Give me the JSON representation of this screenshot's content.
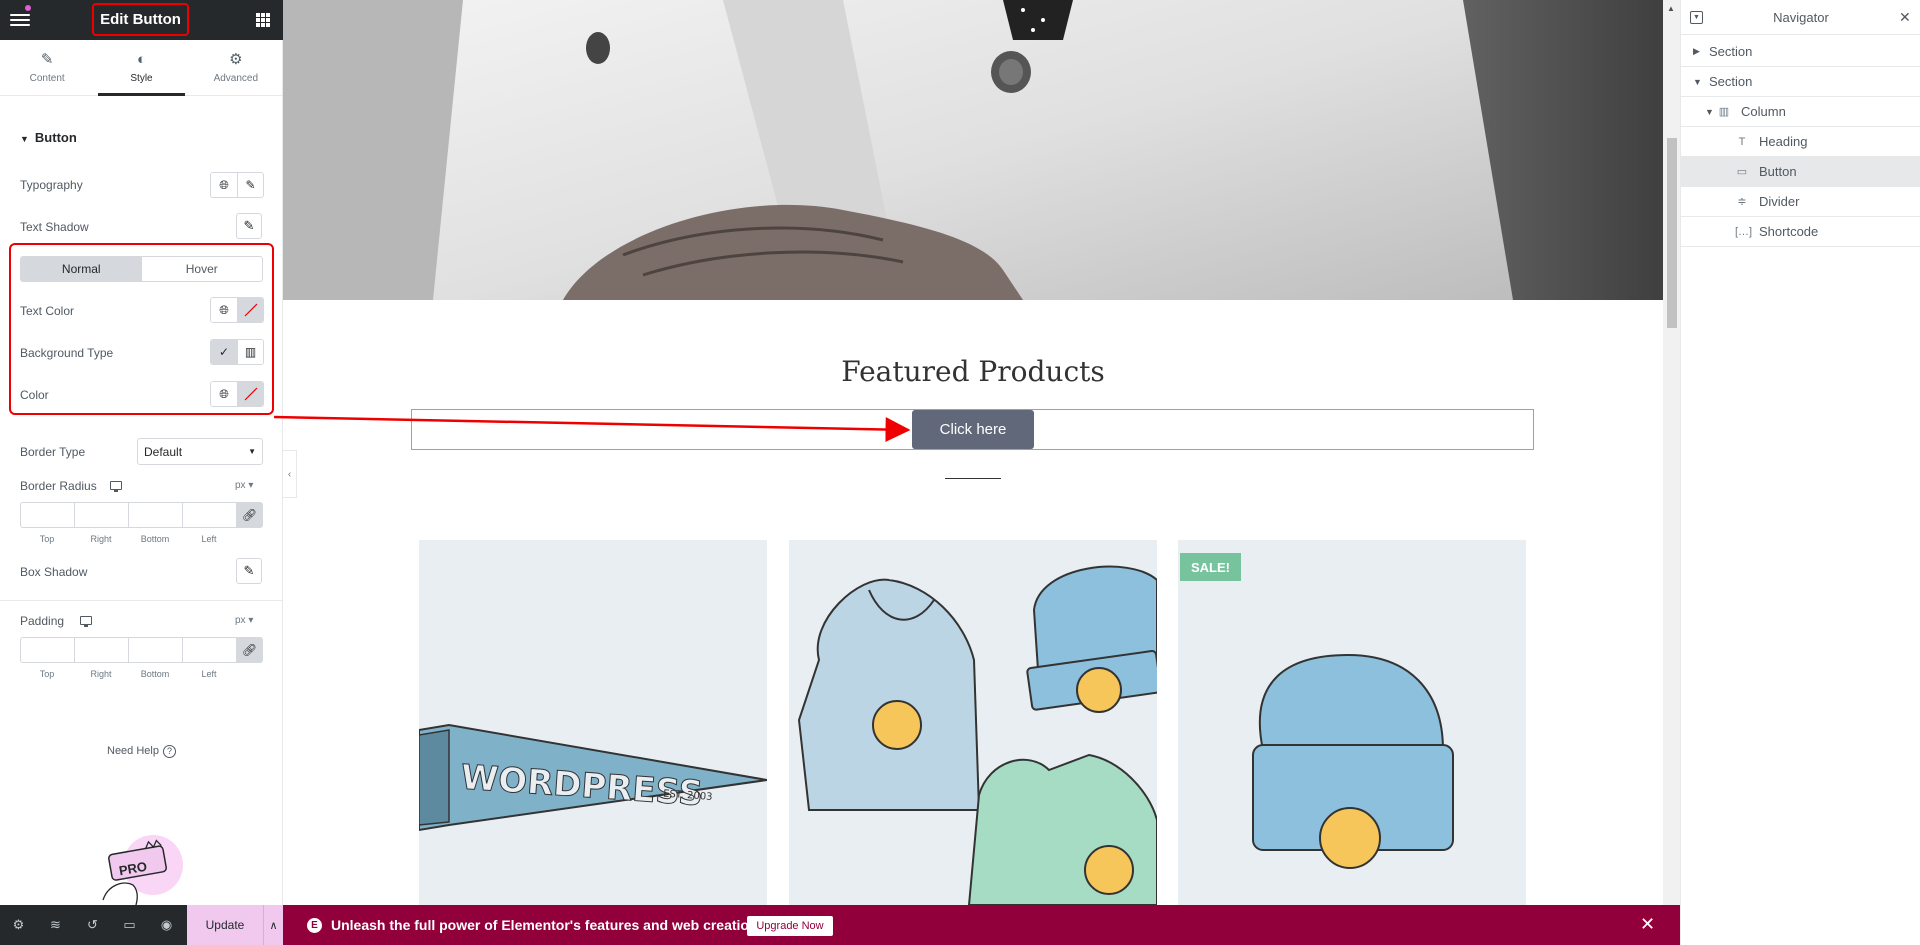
{
  "panel": {
    "title": "Edit Button",
    "tabs": [
      {
        "label": "Content",
        "icon": "pencil-icon"
      },
      {
        "label": "Style",
        "icon": "contrast-icon"
      },
      {
        "label": "Advanced",
        "icon": "gear-icon"
      }
    ],
    "section_title": "Button",
    "controls": {
      "typography": "Typography",
      "text_shadow": "Text Shadow",
      "state_tabs": [
        "Normal",
        "Hover"
      ],
      "text_color": "Text Color",
      "background_type": "Background Type",
      "color": "Color",
      "border_type": "Border Type",
      "border_type_value": "Default",
      "border_radius": "Border Radius",
      "unit": "px",
      "box_shadow": "Box Shadow",
      "padding": "Padding",
      "dimension_labels": [
        "Top",
        "Right",
        "Bottom",
        "Left"
      ]
    },
    "need_help": "Need Help",
    "footer": {
      "icons": [
        "settings-icon",
        "layers-icon",
        "history-icon",
        "responsive-icon",
        "preview-eye-icon"
      ],
      "update_label": "Update"
    }
  },
  "preview": {
    "featured_title": "Featured Products",
    "button_label": "Click here",
    "sale_badge": "SALE!"
  },
  "promo_bar": {
    "text": "Unleash the full power of Elementor's features and web creation tools.",
    "button_label": "Upgrade Now"
  },
  "navigator": {
    "title": "Navigator",
    "items": [
      {
        "label": "Section",
        "level": 0,
        "expanded": false
      },
      {
        "label": "Section",
        "level": 0,
        "expanded": true
      },
      {
        "label": "Column",
        "level": 1,
        "expanded": true
      },
      {
        "label": "Heading",
        "level": 2
      },
      {
        "label": "Button",
        "level": 2,
        "active": true
      },
      {
        "label": "Divider",
        "level": 2
      },
      {
        "label": "Shortcode",
        "level": 2
      }
    ]
  },
  "colors": {
    "panel_dark": "#26292c",
    "highlight_red": "#e00000",
    "promo_bg": "#92003b",
    "update_bg": "#f1c9ef",
    "button_bg": "#61687a",
    "sale_green": "#77c39e"
  }
}
